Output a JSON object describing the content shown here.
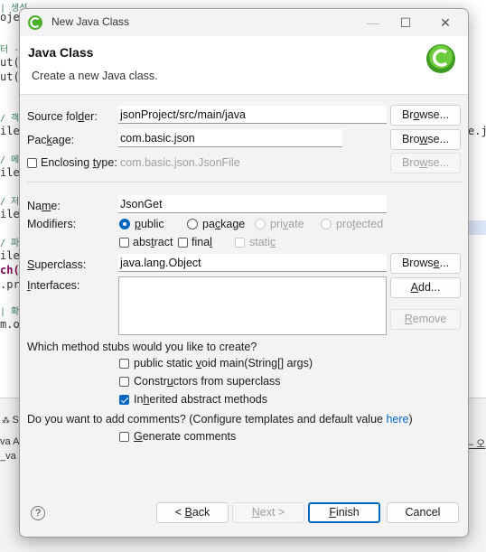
{
  "background": {
    "editor_lines": [
      {
        "text": "| 생성",
        "kind": "c"
      },
      {
        "text": "oje",
        "kind": ""
      },
      {
        "text": "터 -",
        "kind": "c"
      },
      {
        "text": "ut(",
        "kind": ""
      },
      {
        "text": "ut(",
        "kind": ""
      },
      {
        "text": "/ 객",
        "kind": "c"
      },
      {
        "text": "ile",
        "kind": ""
      },
      {
        "text": "/ 메",
        "kind": "c"
      },
      {
        "text": "ile",
        "kind": ""
      },
      {
        "text": "/ 저",
        "kind": "c"
      },
      {
        "text": "ile",
        "kind": ""
      },
      {
        "text": "/ 파",
        "kind": "c"
      },
      {
        "text": "ile",
        "kind": ""
      },
      {
        "text": "ch(",
        "kind": "kw"
      },
      {
        "text": ".pr",
        "kind": ""
      },
      {
        "text": "| 확",
        "kind": "c"
      },
      {
        "text": "m.o",
        "kind": ""
      }
    ],
    "right_fragment": "e.j",
    "panel_tab": "S",
    "panel_left_1": "va A",
    "panel_left_2": "_va",
    "panel_right": "– 오"
  },
  "dialog": {
    "window_title": "New Java Class",
    "header": {
      "title": "Java Class",
      "description": "Create a new Java class."
    },
    "source_folder": {
      "label_pre": "Source fol",
      "label_u": "d",
      "label_post": "er:",
      "value": "jsonProject/src/main/java",
      "browse_pre": "Br",
      "browse_u": "o",
      "browse_post": "wse..."
    },
    "package": {
      "label_pre": "Pac",
      "label_u": "k",
      "label_post": "age:",
      "value": "com.basic.json",
      "browse_pre": "Bro",
      "browse_u": "w",
      "browse_post": "se..."
    },
    "enclosing": {
      "label_pre": "Enclosing ",
      "label_u": "t",
      "label_post": "ype:",
      "value": "com.basic.json.JsonFile",
      "checked": false,
      "browse_pre": "Bro",
      "browse_u": "w",
      "browse_post": "se..."
    },
    "name": {
      "label_pre": "Na",
      "label_u": "m",
      "label_post": "e:",
      "value": "JsonGet"
    },
    "modifiers": {
      "label": "Modifiers:",
      "public": {
        "pre": "",
        "u": "p",
        "post": "ublic",
        "selected": true
      },
      "package": {
        "pre": "pa",
        "u": "c",
        "post": "kage",
        "selected": false
      },
      "private": {
        "pre": "pri",
        "u": "v",
        "post": "ate",
        "selected": false
      },
      "protected": {
        "pre": "pro",
        "u": "t",
        "post": "ected",
        "selected": false
      },
      "abstract": {
        "pre": "abs",
        "u": "t",
        "post": "ract",
        "checked": false
      },
      "final": {
        "pre": "fina",
        "u": "l",
        "post": "",
        "checked": false
      },
      "static": {
        "pre": "stati",
        "u": "c",
        "post": "",
        "checked": false
      }
    },
    "superclass": {
      "label_pre": "",
      "label_u": "S",
      "label_post": "uperclass:",
      "value": "java.lang.Object",
      "browse_pre": "Brows",
      "browse_u": "e",
      "browse_post": "..."
    },
    "interfaces": {
      "label_pre": "",
      "label_u": "I",
      "label_post": "nterfaces:",
      "add_pre": "",
      "add_u": "A",
      "add_post": "dd...",
      "remove_pre": "",
      "remove_u": "R",
      "remove_post": "emove"
    },
    "stubs": {
      "question": "Which method stubs would you like to create?",
      "main": {
        "pre": "public static ",
        "u": "v",
        "post": "oid main(String[] args)",
        "checked": false
      },
      "constructors": {
        "pre": "Constr",
        "u": "u",
        "post": "ctors from superclass",
        "checked": false
      },
      "inherited": {
        "pre": "In",
        "u": "h",
        "post": "erited abstract methods",
        "checked": true
      }
    },
    "comments": {
      "question": "Do you want to add comments? (Configure templates and default value ",
      "link": "here",
      "question_end": ")",
      "generate": {
        "pre": "",
        "u": "G",
        "post": "enerate comments",
        "checked": false
      }
    },
    "footer": {
      "help": "?",
      "back": {
        "pre": "< ",
        "u": "B",
        "post": "ack"
      },
      "next": {
        "pre": "",
        "u": "N",
        "post": "ext >"
      },
      "finish": {
        "pre": "",
        "u": "F",
        "post": "inish"
      },
      "cancel": "Cancel"
    }
  },
  "colors": {
    "accent": "#0067c0",
    "link": "#0066cc",
    "logo_green": "#4caf2a"
  }
}
